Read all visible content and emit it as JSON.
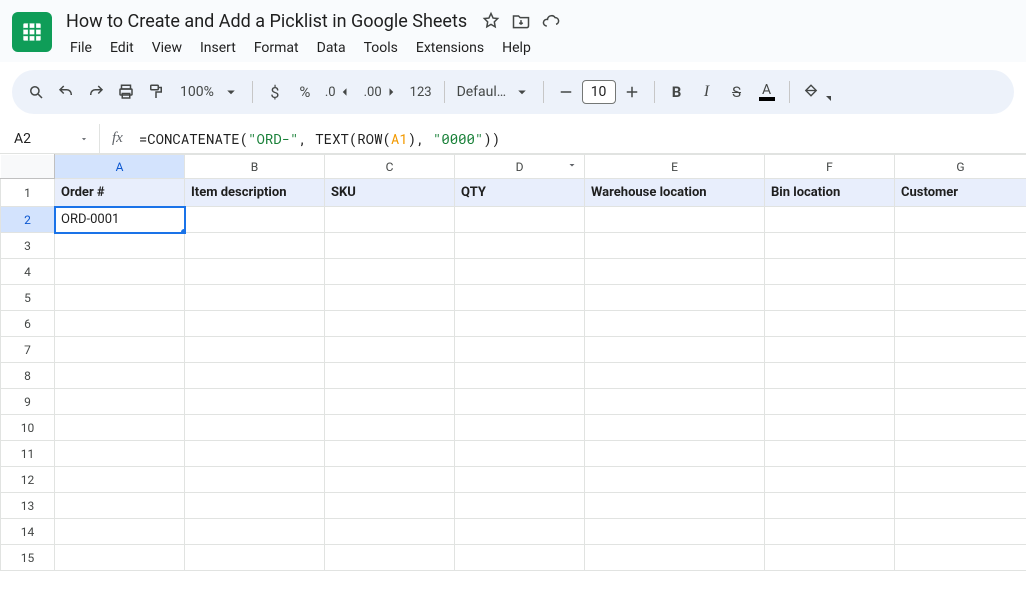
{
  "doc": {
    "title": "How to Create and Add a Picklist in Google Sheets"
  },
  "menu": [
    "File",
    "Edit",
    "View",
    "Insert",
    "Format",
    "Data",
    "Tools",
    "Extensions",
    "Help"
  ],
  "toolbar": {
    "zoom": "100%",
    "font": "Defaul…",
    "font_size": "10",
    "num123": "123"
  },
  "namebox": "A2",
  "formula": {
    "p0": "=CONCATENATE(",
    "s0": "\"ORD-\"",
    "p1": ", TEXT(ROW(",
    "r0": "A1",
    "p2": "), ",
    "s1": "\"0000\"",
    "p3": "))"
  },
  "columns": [
    "A",
    "B",
    "C",
    "D",
    "E",
    "F",
    "G"
  ],
  "headers": {
    "A": "Order #",
    "B": "Item description",
    "C": "SKU",
    "D": "QTY",
    "E": "Warehouse location",
    "F": "Bin location",
    "G": "Customer"
  },
  "cells": {
    "A2": "ORD-0001"
  },
  "row_count": 15,
  "selected_cell": "A2",
  "filter_col": "D"
}
